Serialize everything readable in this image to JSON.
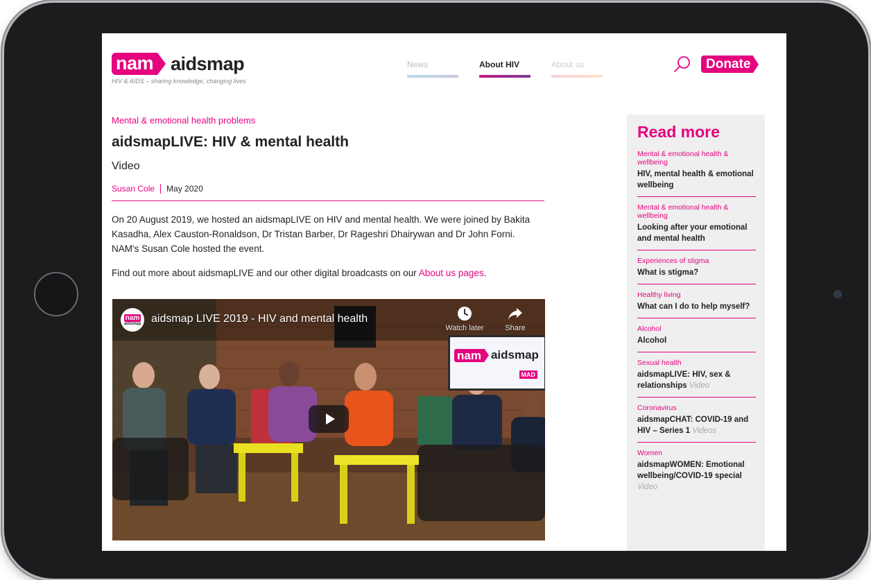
{
  "header": {
    "logo_nam": "nam",
    "logo_text": "aidsmap",
    "tagline": "HIV & AIDS – sharing knowledge, changing lives",
    "nav": [
      {
        "label": "News"
      },
      {
        "label": "About HIV"
      },
      {
        "label": "About us"
      }
    ],
    "donate_label": "Donate"
  },
  "article": {
    "category": "Mental & emotional health problems",
    "title": "aidsmapLIVE: HIV & mental health",
    "subtitle": "Video",
    "author": "Susan Cole",
    "date": "May 2020",
    "para1": "On 20 August 2019, we hosted an aidsmapLIVE on HIV and mental health. We were joined by Bakita Kasadha, Alex Causton-Ronaldson, Dr Tristan Barber, Dr Rageshri Dhairywan and Dr John Forni. NAM's Susan Cole hosted the event.",
    "para2_prefix": "Find out more about aidsmapLIVE and our other digital broadcasts on our ",
    "para2_link": "About us pages",
    "para2_suffix": "."
  },
  "video": {
    "channel_nam": "nam",
    "channel_text": "aidsmap",
    "title": "aidsmap LIVE 2019 - HIV and mental health",
    "watch_later": "Watch later",
    "share": "Share",
    "screen_nam": "nam",
    "screen_text": "aidsmap",
    "screen_badge": "MAD"
  },
  "sidebar": {
    "heading": "Read more",
    "items": [
      {
        "category": "Mental & emotional health & wellbeing",
        "title": "HIV, mental health & emotional wellbeing",
        "type": ""
      },
      {
        "category": "Mental & emotional health & wellbeing",
        "title": "Looking after your emotional and mental health",
        "type": ""
      },
      {
        "category": "Experiences of stigma",
        "title": "What is stigma?",
        "type": ""
      },
      {
        "category": "Healthy living",
        "title": "What can I do to help myself?",
        "type": ""
      },
      {
        "category": "Alcohol",
        "title": "Alcohol",
        "type": ""
      },
      {
        "category": "Sexual health",
        "title": "aidsmapLIVE: HIV, sex & relationships",
        "type": "Video"
      },
      {
        "category": "Coronavirus",
        "title": "aidsmapCHAT: COVID-19 and HIV – Series 1",
        "type": "Videos"
      },
      {
        "category": "Women",
        "title": "aidsmapWOMEN: Emotional wellbeing/COVID-19 special",
        "type": "Video"
      }
    ]
  },
  "colors": {
    "brand_pink": "#e5037f",
    "text": "#222222",
    "sidebar_bg": "#efefef",
    "device_frame": "#1c1c1e"
  },
  "icons": [
    "search-icon",
    "clock-icon",
    "share-arrow-icon",
    "play-icon",
    "home-button-icon"
  ]
}
